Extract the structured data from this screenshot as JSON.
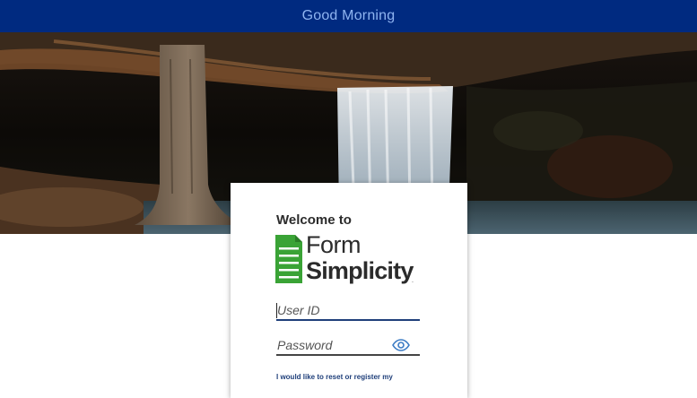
{
  "header": {
    "greeting": "Good Morning"
  },
  "hero": {
    "image": "waterfall-forest-photo"
  },
  "login": {
    "welcome": "Welcome to",
    "logo": {
      "line1": "Form",
      "line2": "Simplicity",
      "tm": "."
    },
    "userid": {
      "placeholder": "User ID",
      "value": ""
    },
    "password": {
      "placeholder": "Password",
      "value": ""
    },
    "reset_link": "I would like to reset or register my"
  },
  "colors": {
    "topbar": "#002a80",
    "greeting": "#8fb4f0",
    "accent": "#1f3f7a",
    "logo_green": "#3aa336",
    "eye_icon": "#3b7bc4"
  },
  "icons": {
    "password_toggle": "eye-icon",
    "logo_mark": "document-icon"
  }
}
